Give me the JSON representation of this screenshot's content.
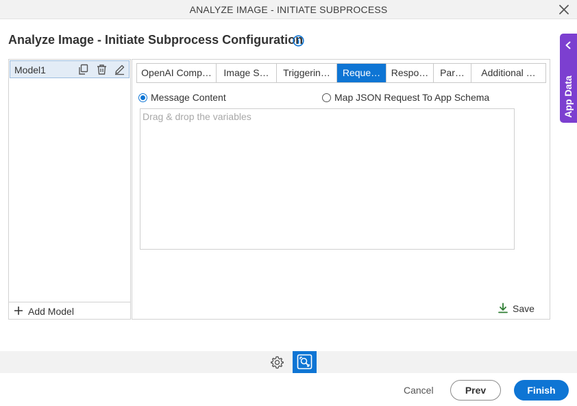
{
  "window": {
    "title": "ANALYZE IMAGE - INITIATE SUBPROCESS",
    "close_icon": "close-icon"
  },
  "header": {
    "title": "Analyze Image - Initiate Subprocess Configuration",
    "info_icon": "info-icon"
  },
  "app_data_tab": {
    "label": "App Data",
    "color": "#7c3fd0"
  },
  "models": {
    "items": [
      {
        "name": "Model1"
      }
    ],
    "add_label": "Add Model"
  },
  "tabs": [
    {
      "label": "OpenAI Comp…",
      "active": false
    },
    {
      "label": "Image S…",
      "active": false
    },
    {
      "label": "Triggerin…",
      "active": false
    },
    {
      "label": "Reque…",
      "active": true
    },
    {
      "label": "Respo…",
      "active": false
    },
    {
      "label": "Par…",
      "active": false
    },
    {
      "label": "Additional …",
      "active": false
    }
  ],
  "request": {
    "option_message": "Message Content",
    "option_map": "Map JSON Request To App Schema",
    "selected": "Message Content",
    "placeholder": "Drag & drop the variables"
  },
  "save_label": "Save",
  "footer": {
    "cancel": "Cancel",
    "prev": "Prev",
    "finish": "Finish"
  },
  "colors": {
    "accent": "#0e75d4",
    "app_data": "#7c3fd0",
    "save_icon": "#2e7d32"
  }
}
